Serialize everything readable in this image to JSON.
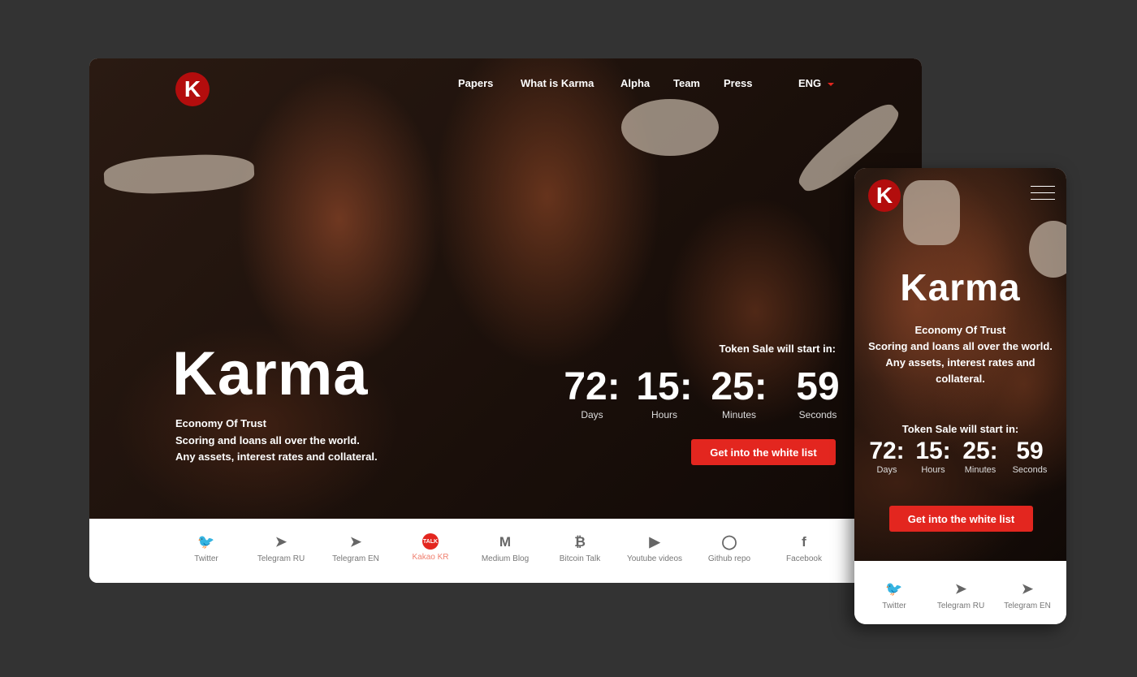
{
  "desktop": {
    "nav": [
      "Papers",
      "What is Karma",
      "Alpha",
      "Team",
      "Press"
    ],
    "lang": "ENG",
    "logo": "K",
    "title": "Karma",
    "subtitle": [
      "Economy Of Trust",
      "Scoring and loans all over the world.",
      "Any assets, interest rates and collateral."
    ],
    "countdown_label": "Token Sale will start in:",
    "countdown": [
      {
        "n": "72:",
        "l": "Days"
      },
      {
        "n": "15:",
        "l": "Hours"
      },
      {
        "n": "25:",
        "l": "Minutes"
      },
      {
        "n": "59",
        "l": "Seconds"
      }
    ],
    "cta": "Get into the white list",
    "social": [
      {
        "label": "Twitter",
        "icon": "twitter-icon",
        "glyph": "🐦"
      },
      {
        "label": "Telegram RU",
        "icon": "telegram-icon",
        "glyph": "➤"
      },
      {
        "label": "Telegram EN",
        "icon": "telegram-icon",
        "glyph": "➤"
      },
      {
        "label": "Kakao KR",
        "icon": "kakao-talk-icon",
        "glyph": "TALK"
      },
      {
        "label": "Medium Blog",
        "icon": "medium-icon",
        "glyph": "M"
      },
      {
        "label": "Bitcoin Talk",
        "icon": "bitcoin-icon",
        "glyph": "₿"
      },
      {
        "label": "Youtube videos",
        "icon": "youtube-icon",
        "glyph": "▶"
      },
      {
        "label": "Github repo",
        "icon": "github-icon",
        "glyph": "◯"
      },
      {
        "label": "Facebook",
        "icon": "facebook-icon",
        "glyph": "f"
      }
    ]
  },
  "mobile": {
    "logo": "K",
    "title": "Karma",
    "subtitle": [
      "Economy Of Trust",
      "Scoring and loans all over the world.",
      "Any assets, interest rates and",
      "collateral."
    ],
    "countdown_label": "Token Sale will start in:",
    "countdown": [
      {
        "n": "72:",
        "l": "Days"
      },
      {
        "n": "15:",
        "l": "Hours"
      },
      {
        "n": "25:",
        "l": "Minutes"
      },
      {
        "n": "59",
        "l": "Seconds"
      }
    ],
    "cta": "Get into the white list",
    "social": [
      {
        "label": "Twitter",
        "icon": "twitter-icon",
        "glyph": "🐦"
      },
      {
        "label": "Telegram RU",
        "icon": "telegram-icon",
        "glyph": "➤"
      },
      {
        "label": "Telegram EN",
        "icon": "telegram-icon",
        "glyph": "➤"
      }
    ]
  },
  "colors": {
    "accent": "#e3261f",
    "logo": "#b30d0d",
    "background": "#333333",
    "highlight_link": "#f08070"
  }
}
